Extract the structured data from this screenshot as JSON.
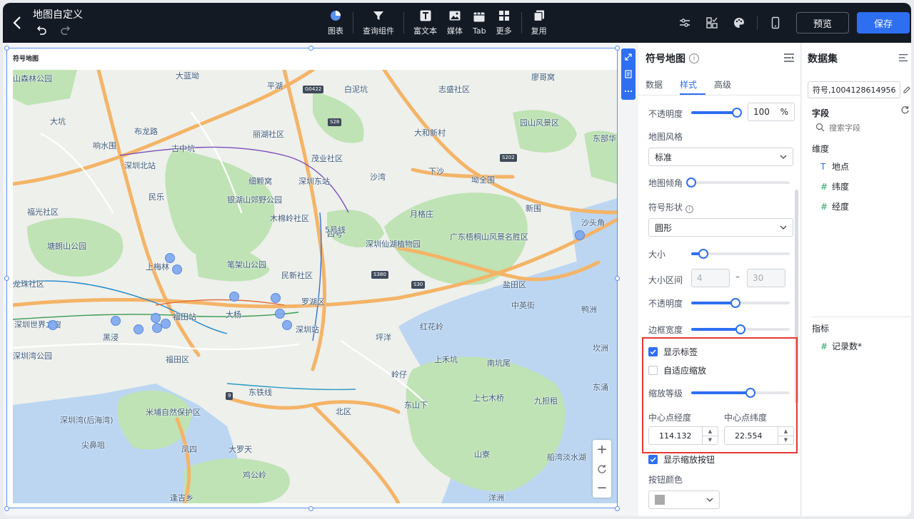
{
  "header": {
    "title": "地图自定义",
    "tools": [
      {
        "label": "图表",
        "icon": "pie-chart-icon"
      },
      {
        "label": "查询组件",
        "icon": "filter-icon"
      },
      {
        "label": "富文本",
        "icon": "text-icon"
      },
      {
        "label": "媒体",
        "icon": "image-icon"
      },
      {
        "label": "Tab",
        "icon": "tab-icon"
      },
      {
        "label": "更多",
        "icon": "grid-icon"
      },
      {
        "label": "复用",
        "icon": "copy-icon"
      }
    ],
    "preview_label": "预览",
    "save_label": "保存"
  },
  "widget": {
    "title": "符号地图"
  },
  "map": {
    "labels": [
      {
        "text": "山森林公园"
      },
      {
        "text": "大蓝坳"
      },
      {
        "text": "平湖"
      },
      {
        "text": "白泥坑"
      },
      {
        "text": "志盛社区"
      },
      {
        "text": "廖哥窝"
      },
      {
        "text": "大坑"
      },
      {
        "text": "布龙路"
      },
      {
        "text": "丽湖社区"
      },
      {
        "text": "大和新村"
      },
      {
        "text": "园山风景区"
      },
      {
        "text": "响水围"
      },
      {
        "text": "古中坑"
      },
      {
        "text": "茂业社区"
      },
      {
        "text": "东部华"
      },
      {
        "text": "深圳北站"
      },
      {
        "text": "细颗窝"
      },
      {
        "text": "深圳东站"
      },
      {
        "text": "沙湾"
      },
      {
        "text": "下沙"
      },
      {
        "text": "坳全围"
      },
      {
        "text": "民乐"
      },
      {
        "text": "银湖山郊野公园"
      },
      {
        "text": "福光社区"
      },
      {
        "text": "木棉岭社区"
      },
      {
        "text": "月格庄"
      },
      {
        "text": "新围"
      },
      {
        "text": "沙头角"
      },
      {
        "text": "塘朗山公园"
      },
      {
        "text": "深圳仙湖植物园"
      },
      {
        "text": "广东梧桐山风景名胜区"
      },
      {
        "text": "上梅林"
      },
      {
        "text": "笔架山公园"
      },
      {
        "text": "民新社区"
      },
      {
        "text": "盐田区"
      },
      {
        "text": "龙珠社区"
      },
      {
        "text": "罗湖区"
      },
      {
        "text": "中英街"
      },
      {
        "text": "福田站"
      },
      {
        "text": "大杨"
      },
      {
        "text": "鸭洲"
      },
      {
        "text": "深圳世界之窗"
      },
      {
        "text": "黑浸"
      },
      {
        "text": "深圳站"
      },
      {
        "text": "红花岭"
      },
      {
        "text": "坪洋"
      },
      {
        "text": "深圳湾公园"
      },
      {
        "text": "福田区"
      },
      {
        "text": "上禾坑"
      },
      {
        "text": "南坑尾"
      },
      {
        "text": "坎洲"
      },
      {
        "text": "岭仔"
      },
      {
        "text": "东铁线"
      },
      {
        "text": "东涌"
      },
      {
        "text": "上七木桥"
      },
      {
        "text": "九担租"
      },
      {
        "text": "东山下"
      },
      {
        "text": "深圳湾(后海湾)"
      },
      {
        "text": "米埔自然保护区"
      },
      {
        "text": "北区"
      },
      {
        "text": "尖鼻咀"
      },
      {
        "text": "大罗天"
      },
      {
        "text": "凤四"
      },
      {
        "text": "山寮"
      },
      {
        "text": "船湾淡水湖"
      },
      {
        "text": "鸡公岭"
      },
      {
        "text": "洋洲"
      },
      {
        "text": "逢吉乡"
      },
      {
        "text": "四号"
      },
      {
        "text": "5号线"
      }
    ],
    "shields": [
      "G0422",
      "S28",
      "S202",
      "S380",
      "S30",
      "9"
    ],
    "zoom_in": "+",
    "zoom_out": "−"
  },
  "style_panel": {
    "title": "符号地图",
    "tabs": [
      "数据",
      "样式",
      "高级"
    ],
    "active_tab": "样式",
    "opacity_label": "不透明度",
    "opacity_value": "100",
    "opacity_unit": "%",
    "map_style_label": "地图风格",
    "map_style_value": "标准",
    "tilt_label": "地图倾角",
    "symbol_shape_label": "符号形状",
    "symbol_shape_value": "圆形",
    "size_label": "大小",
    "size_range_label": "大小区间",
    "size_range_min": "4",
    "size_range_max": "30",
    "size_range_sep": "–",
    "symbol_opacity_label": "不透明度",
    "border_width_label": "边框宽度",
    "show_label": "显示标签",
    "show_label_checked": true,
    "adaptive_zoom": "自适应缩放",
    "adaptive_zoom_checked": false,
    "zoom_level_label": "缩放等级",
    "center_lng_label": "中心点经度",
    "center_lat_label": "中心点纬度",
    "center_lng": "114.132",
    "center_lat": "22.554",
    "show_zoom_btn": "显示缩放按钮",
    "show_zoom_btn_checked": true,
    "btn_color_label": "按钮颜色",
    "sliders": {
      "opacity": 1.0,
      "tilt": 0.0,
      "size": 0.12,
      "symbol_opacity": 0.45,
      "border_width": 0.5,
      "zoom_level": 0.6
    }
  },
  "dataset": {
    "title": "数据集",
    "selected": "符号,1004128614956",
    "fields_title": "字段",
    "search_placeholder": "搜索字段",
    "dimension_title": "维度",
    "dimensions": [
      {
        "type": "T",
        "name": "地点"
      },
      {
        "type": "#",
        "name": "纬度"
      },
      {
        "type": "#",
        "name": "经度"
      }
    ],
    "metric_title": "指标",
    "metrics": [
      {
        "type": "#",
        "name": "记录数*"
      }
    ]
  },
  "colors": {
    "accent": "#2e6ff2",
    "topbar": "#141a24",
    "highlight": "#e53935",
    "marker": "#7ea7f0"
  }
}
